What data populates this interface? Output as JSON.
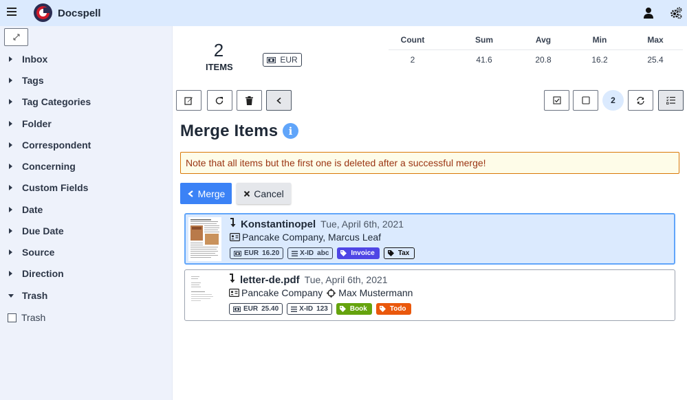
{
  "app": {
    "title": "Docspell"
  },
  "sidebar": {
    "items": [
      {
        "label": "Inbox"
      },
      {
        "label": "Tags"
      },
      {
        "label": "Tag Categories"
      },
      {
        "label": "Folder"
      },
      {
        "label": "Correspondent"
      },
      {
        "label": "Concerning"
      },
      {
        "label": "Custom Fields"
      },
      {
        "label": "Date"
      },
      {
        "label": "Due Date"
      },
      {
        "label": "Source"
      },
      {
        "label": "Direction"
      },
      {
        "label": "Trash"
      }
    ],
    "trash_checkbox": {
      "label": "Trash",
      "checked": false
    }
  },
  "stats": {
    "count": "2",
    "count_label": "ITEMS",
    "currency": "EUR",
    "headers": [
      "Count",
      "Sum",
      "Avg",
      "Min",
      "Max"
    ],
    "values": [
      "2",
      "41.6",
      "20.8",
      "16.2",
      "25.4"
    ]
  },
  "toolbar": {
    "selection_count": "2"
  },
  "merge": {
    "title": "Merge Items",
    "note": "Note that all items but the first one is deleted after a successful merge!",
    "merge_label": "Merge",
    "cancel_label": "Cancel"
  },
  "items": [
    {
      "name": "Konstantinopel",
      "date": "Tue, April 6th, 2021",
      "correspondent": "Pancake Company, Marcus Leaf",
      "concerning": "",
      "amount_currency": "EUR",
      "amount": "16.20",
      "field_label": "X-ID",
      "field_value": "abc",
      "tags": [
        {
          "label": "Invoice",
          "color": "#4f46e5",
          "outline": false
        },
        {
          "label": "Tax",
          "color": "#111111",
          "outline": true
        }
      ]
    },
    {
      "name": "letter-de.pdf",
      "date": "Tue, April 6th, 2021",
      "correspondent": "Pancake Company",
      "concerning": "Max Mustermann",
      "amount_currency": "EUR",
      "amount": "25.40",
      "field_label": "X-ID",
      "field_value": "123",
      "tags": [
        {
          "label": "Book",
          "color": "#65a30d",
          "outline": false
        },
        {
          "label": "Todo",
          "color": "#ea580c",
          "outline": false
        }
      ]
    }
  ],
  "colors": {
    "topbar": "#dbeafe",
    "sidebar": "#eef2fb",
    "primary": "#3b82f6",
    "note_bg": "#fefce8",
    "note_text": "#9a3412"
  }
}
